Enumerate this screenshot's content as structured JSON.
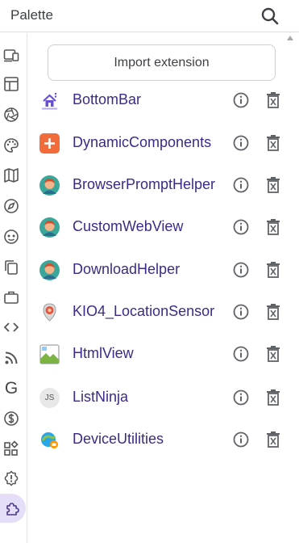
{
  "header": {
    "title": "Palette",
    "search_icon": "search-icon"
  },
  "rail": {
    "items": [
      {
        "icon": "devices-icon"
      },
      {
        "icon": "layout-icon"
      },
      {
        "icon": "camera-aperture-icon"
      },
      {
        "icon": "palette-icon"
      },
      {
        "icon": "map-icon"
      },
      {
        "icon": "compass-icon"
      },
      {
        "icon": "face-icon"
      },
      {
        "icon": "copy-icon"
      },
      {
        "icon": "briefcase-icon"
      },
      {
        "icon": "code-icon"
      },
      {
        "icon": "rss-icon"
      },
      {
        "icon": "google-g-icon",
        "text": "G"
      },
      {
        "icon": "dollar-icon"
      },
      {
        "icon": "widgets-icon"
      },
      {
        "icon": "alert-icon"
      },
      {
        "icon": "extension-icon",
        "active": true
      }
    ]
  },
  "import_button": {
    "label": "Import extension"
  },
  "extensions": [
    {
      "name": "BottomBar",
      "icon": "home-bar-icon"
    },
    {
      "name": "DynamicComponents",
      "icon": "plus-square-icon"
    },
    {
      "name": "BrowserPromptHelper",
      "icon": "avatar-icon"
    },
    {
      "name": "CustomWebView",
      "icon": "avatar-icon"
    },
    {
      "name": "DownloadHelper",
      "icon": "avatar-icon"
    },
    {
      "name": "KIO4_LocationSensor",
      "icon": "location-pin-icon"
    },
    {
      "name": "HtmlView",
      "icon": "broken-image-icon"
    },
    {
      "name": "ListNinja",
      "icon": "js-badge-icon",
      "badge_text": "JS"
    },
    {
      "name": "DeviceUtilities",
      "icon": "device-utilities-icon"
    }
  ],
  "colors": {
    "item_text": "#3c2a86",
    "active_rail": "#e6ddf8",
    "icon_gray": "#5f6368"
  }
}
